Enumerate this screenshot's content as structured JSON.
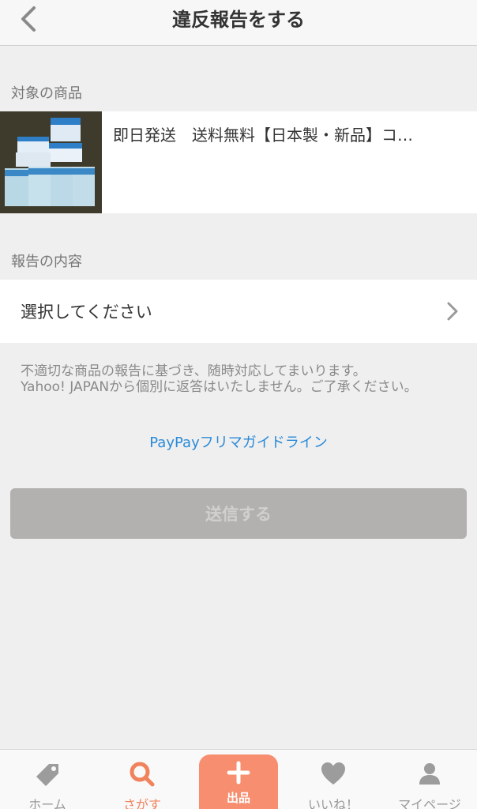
{
  "header": {
    "title": "違反報告をする"
  },
  "target_section": {
    "label": "対象の商品",
    "product_title": "即日発送　送料無料【日本製・新品】コ…"
  },
  "report_section": {
    "label": "報告の内容",
    "select_placeholder": "選択してください"
  },
  "notice": {
    "line1": "不適切な商品の報告に基づき、随時対応してまいります。",
    "line2": "Yahoo! JAPANから個別に返答はいたしません。ご了承ください。"
  },
  "guideline_link": "PayPayフリマガイドライン",
  "submit_label": "送信する",
  "tabbar": {
    "home": "ホーム",
    "search": "さがす",
    "sell": "出品",
    "likes": "いいね！",
    "mypage": "マイページ"
  },
  "colors": {
    "accent": "#f0835c",
    "sell_button": "#f78e6f",
    "link": "#2a8ad8",
    "disabled_button": "#b3b0b0"
  },
  "icons": [
    "chevron-left-icon",
    "chevron-right-icon",
    "tag-icon",
    "search-icon",
    "plus-icon",
    "heart-icon",
    "person-icon"
  ]
}
